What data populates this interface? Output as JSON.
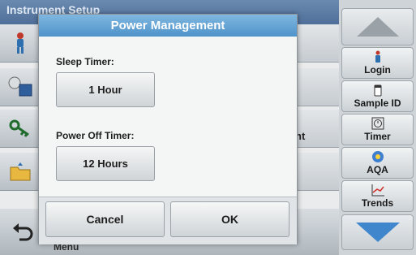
{
  "background": {
    "header_title": "Instrument Setup",
    "row_partial_text": "nt",
    "bottom_partial_text": "Menu"
  },
  "dialog": {
    "title": "Power Management",
    "sleep_timer_label": "Sleep Timer:",
    "sleep_timer_value": "1 Hour",
    "power_off_timer_label": "Power Off Timer:",
    "power_off_timer_value": "12 Hours",
    "cancel_label": "Cancel",
    "ok_label": "OK"
  },
  "sidebar": {
    "login_label": "Login",
    "sample_id_label": "Sample ID",
    "timer_label": "Timer",
    "aqa_label": "AQA",
    "trends_label": "Trends"
  },
  "colors": {
    "title_bar": "#5a9bd0",
    "header_bg": "#5b7ca5",
    "arrow": "#3f86cc"
  },
  "icons": [
    "operator-icon",
    "instrument-icon",
    "key-icon",
    "folder-icon",
    "back-icon",
    "login-icon",
    "sample-id-icon",
    "timer-icon",
    "aqa-icon",
    "trends-icon",
    "scroll-up-icon",
    "scroll-down-icon"
  ]
}
